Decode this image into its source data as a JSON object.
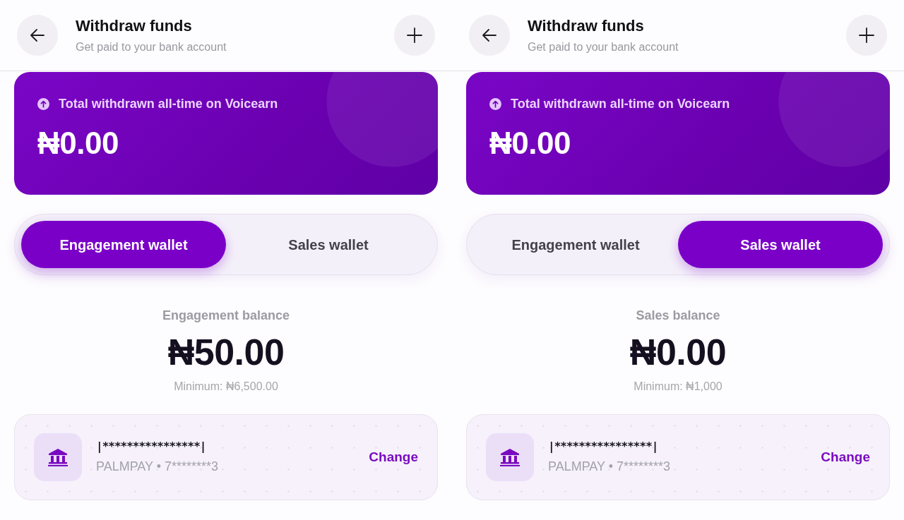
{
  "screens": [
    {
      "header": {
        "title": "Withdraw funds",
        "subtitle": "Get paid to your bank account"
      },
      "total_card": {
        "label": "Total withdrawn all-time on Voicearn",
        "amount": "₦0.00"
      },
      "wallet_tabs": [
        {
          "label": "Engagement wallet",
          "selected": true
        },
        {
          "label": "Sales wallet",
          "selected": false
        }
      ],
      "balance": {
        "label": "Engagement balance",
        "amount": "₦50.00",
        "minimum": "Minimum: ₦6,500.00"
      },
      "bank_account": {
        "name": "|****************|",
        "detail": "PALMPAY • 7********3",
        "action": "Change"
      }
    },
    {
      "header": {
        "title": "Withdraw funds",
        "subtitle": "Get paid to your bank account"
      },
      "total_card": {
        "label": "Total withdrawn all-time on Voicearn",
        "amount": "₦0.00"
      },
      "wallet_tabs": [
        {
          "label": "Engagement wallet",
          "selected": false
        },
        {
          "label": "Sales wallet",
          "selected": true
        }
      ],
      "balance": {
        "label": "Sales balance",
        "amount": "₦0.00",
        "minimum": "Minimum: ₦1,000"
      },
      "bank_account": {
        "name": "|****************|",
        "detail": "PALMPAY • 7********3",
        "action": "Change"
      }
    }
  ]
}
